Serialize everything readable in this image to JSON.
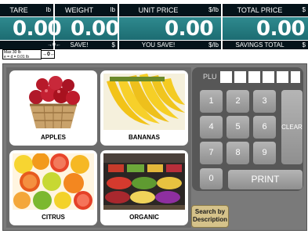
{
  "display": {
    "tare": {
      "label": "TARE",
      "unit": "lb",
      "value": "0.00"
    },
    "weight": {
      "label": "WEIGHT",
      "unit": "lb",
      "value": "0.00"
    },
    "unit_price": {
      "label": "UNIT PRICE",
      "unit": "$/lb",
      "value": "0.00"
    },
    "total_price": {
      "label": "TOTAL PRICE",
      "unit": "$",
      "value": "0.00"
    },
    "zero_indicator": "→0←",
    "save": {
      "label": "SAVE!",
      "unit": "$"
    },
    "you_save": {
      "label": "YOU SAVE!",
      "unit": "$/lb"
    },
    "savings_total": {
      "label": "SAVINGS TOTAL",
      "unit": "$"
    },
    "capacity_line1": "Max 30 lb",
    "capacity_line2": "e = d = 0.01 lb",
    "zero_button": "→0←"
  },
  "products": [
    {
      "label": "APPLES",
      "icon": "apples-basket"
    },
    {
      "label": "BANANAS",
      "icon": "bananas"
    },
    {
      "label": "CITRUS",
      "icon": "citrus-fruits"
    },
    {
      "label": "ORGANIC",
      "icon": "produce-stand"
    }
  ],
  "keypad": {
    "plu_label": "PLU",
    "keys": [
      "1",
      "2",
      "3",
      "4",
      "5",
      "6",
      "7",
      "8",
      "9",
      "0"
    ],
    "clear_label": "CLEAR",
    "print_label": "PRINT"
  },
  "search": {
    "line1": "Search by",
    "line2": "Description"
  },
  "colors": {
    "display_bg": "#1c6c72",
    "header_bg": "#05131a",
    "panel_bg": "#7a7a7a",
    "search_btn": "#d5c28a"
  }
}
